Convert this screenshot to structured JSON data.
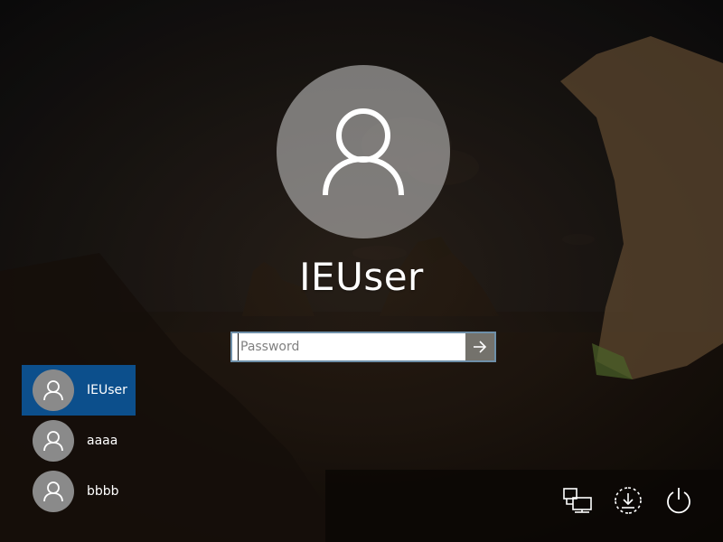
{
  "login": {
    "username": "IEUser",
    "password_placeholder": "Password"
  },
  "users": [
    {
      "name": "IEUser",
      "selected": true
    },
    {
      "name": "aaaa",
      "selected": false
    },
    {
      "name": "bbbb",
      "selected": false
    }
  ],
  "icons": {
    "large_avatar": "user-icon",
    "submit": "arrow-right-icon",
    "network": "network-icon",
    "ease_of_access": "ease-of-access-icon",
    "power": "power-icon"
  },
  "colors": {
    "selected_user_bg": "#0c4f8c",
    "submit_button_bg": "#74726c",
    "avatar_bg": "#8a8a8a"
  }
}
